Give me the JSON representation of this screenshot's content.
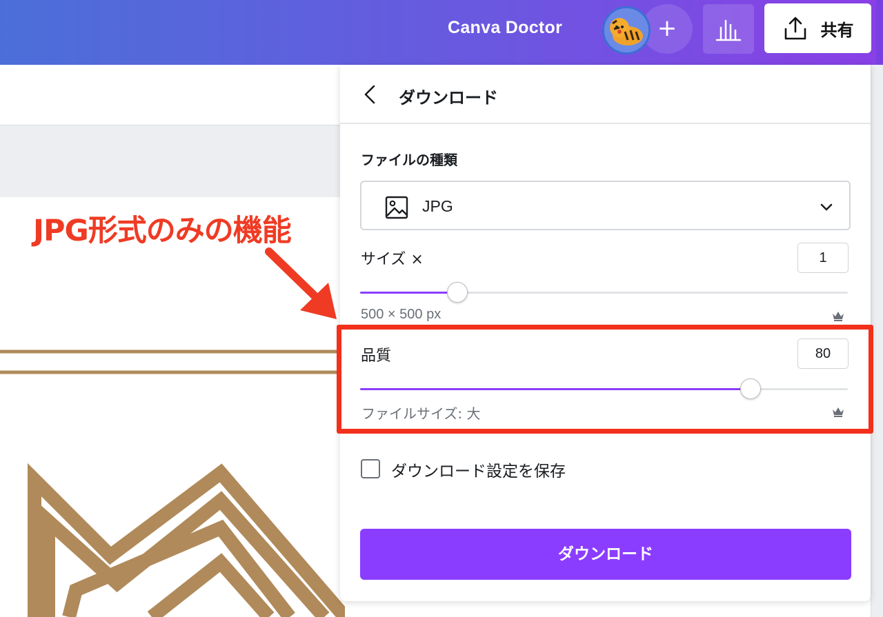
{
  "topbar": {
    "brand": "Canva Doctor",
    "plus_label": "+",
    "share_label": "共有"
  },
  "annotation": {
    "text": "JPG形式のみの機能"
  },
  "download_panel": {
    "title": "ダウンロード",
    "file_type_label": "ファイルの種類",
    "file_type_value": "JPG",
    "size_label": "サイズ ×",
    "size_value": "1",
    "size_slider_fraction": 0.2,
    "dimensions": "500 × 500 px",
    "quality_label": "品質",
    "quality_value": "80",
    "quality_slider_fraction": 0.8,
    "file_size_text": "ファイルサイズ: 大",
    "save_settings_label": "ダウンロード設定を保存",
    "save_settings_checked": false,
    "download_button": "ダウンロード"
  },
  "colors": {
    "accent": "#8b3dff",
    "annotation_red": "#ef3b24",
    "highlight_frame": "#f2301b",
    "design_gold": "#b08a5a",
    "topbar_start": "#4b6fd8",
    "topbar_end": "#8a3fe6"
  },
  "icons": [
    "avatar-tiger",
    "plus-icon",
    "insights-icon",
    "share-upload-icon",
    "back-chevron-icon",
    "image-icon",
    "chevron-down-icon",
    "crown-icon",
    "checkbox-icon",
    "arrow-annotation"
  ]
}
